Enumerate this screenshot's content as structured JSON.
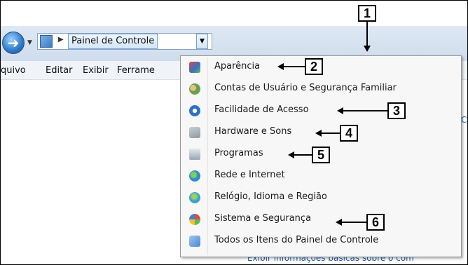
{
  "address_bar": {
    "breadcrumb": "Painel de Controle",
    "back_glyph": "➜"
  },
  "menubar": {
    "items": [
      "quivo",
      "Editar",
      "Exibir",
      "Ferrame"
    ]
  },
  "dropdown": {
    "items": [
      {
        "label": "Aparência",
        "icon": "appearance-icon",
        "color": "#3b6fc4"
      },
      {
        "label": "Contas de Usuário e Segurança Familiar",
        "icon": "user-accounts-icon",
        "color": "#6aa04a"
      },
      {
        "label": "Facilidade de Acesso",
        "icon": "ease-of-access-icon",
        "color": "#2f6fc9"
      },
      {
        "label": "Hardware e Sons",
        "icon": "hardware-sound-icon",
        "color": "#8f98a3"
      },
      {
        "label": "Programas",
        "icon": "programs-icon",
        "color": "#9aa7b5"
      },
      {
        "label": "Rede e Internet",
        "icon": "network-icon",
        "color": "#2d8bd0"
      },
      {
        "label": "Relógio, Idioma e Região",
        "icon": "clock-language-icon",
        "color": "#3aa0d8"
      },
      {
        "label": "Sistema e Segurança",
        "icon": "system-security-icon",
        "color": "#d9a03a"
      },
      {
        "label": "Todos os Itens do Painel de Controle",
        "icon": "control-panel-icon",
        "color": "#4a88cf"
      }
    ]
  },
  "callouts": [
    "1",
    "2",
    "3",
    "4",
    "5",
    "6"
  ],
  "background": {
    "edge_text": "C",
    "bottom_link": "Exibir informações básicas sobre o com"
  }
}
